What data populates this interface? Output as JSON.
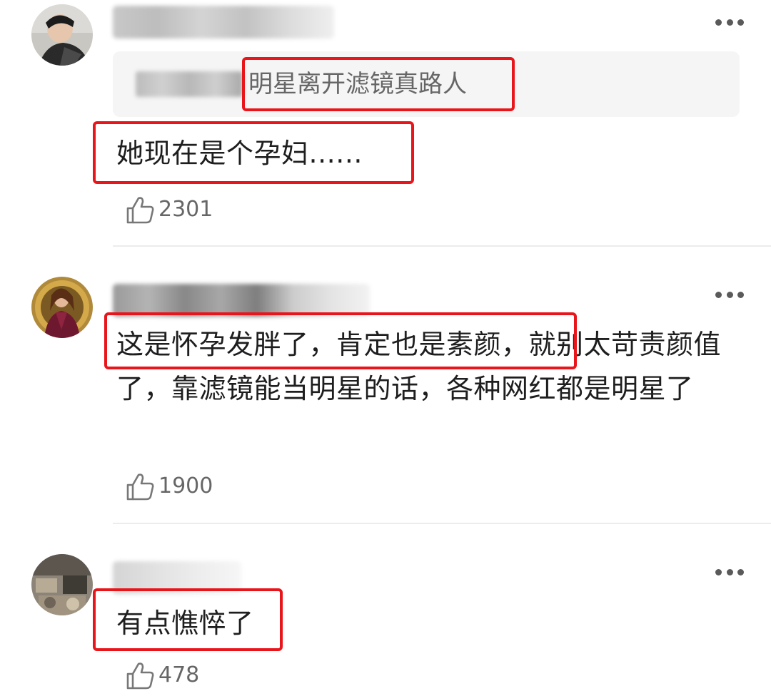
{
  "comments": [
    {
      "quote": "明星离开滤镜真路人",
      "text": "她现在是个孕妇......",
      "likes": "2301"
    },
    {
      "text": "这是怀孕发胖了，肯定也是素颜，就别太苛责颜值了，靠滤镜能当明星的话，各种网红都是明星了",
      "likes": "1900"
    },
    {
      "text": "有点憔悴了",
      "likes": "478"
    }
  ],
  "icons": {
    "like": "thumbs-up-icon",
    "more": "more-dots-icon"
  },
  "colors": {
    "highlight": "#e8151b",
    "quote_bg": "#f5f5f5",
    "divider": "#ececec"
  }
}
